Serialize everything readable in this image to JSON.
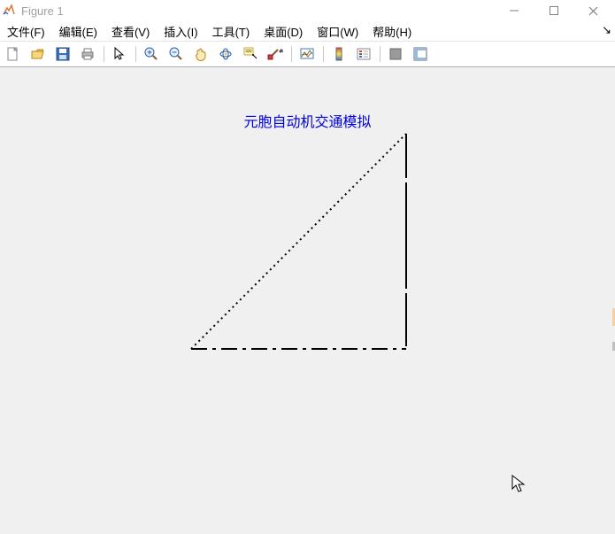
{
  "window": {
    "title": "Figure 1"
  },
  "menu": {
    "file": "文件(F)",
    "edit": "编辑(E)",
    "view": "查看(V)",
    "insert": "插入(I)",
    "tools": "工具(T)",
    "desktop": "桌面(D)",
    "window": "窗口(W)",
    "help": "帮助(H)"
  },
  "plot": {
    "title": "元胞自动机交通模拟"
  },
  "icons": {
    "new": "new-icon",
    "open": "open-icon",
    "save": "save-icon",
    "print": "print-icon",
    "pointer": "pointer-icon",
    "zoomin": "zoom-in-icon",
    "zoomout": "zoom-out-icon",
    "pan": "pan-icon",
    "rotate": "rotate-3d-icon",
    "datacursor": "data-cursor-icon",
    "brush": "brush-icon",
    "link": "link-icon",
    "colorbar": "colorbar-icon",
    "legend": "legend-icon",
    "hideplot": "hide-plot-tools-icon",
    "showplot": "show-plot-tools-icon"
  }
}
